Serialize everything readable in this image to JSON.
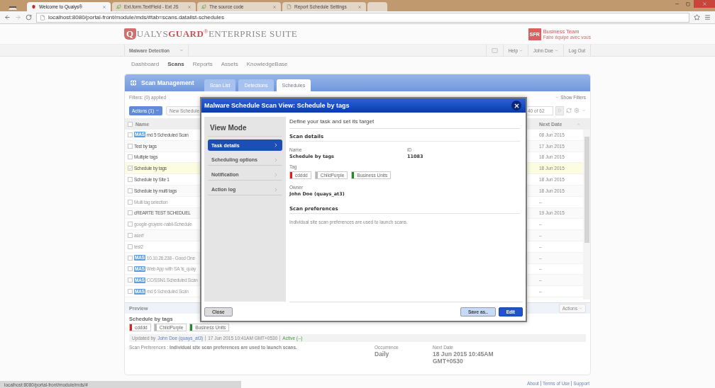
{
  "browser": {
    "tabs": [
      {
        "title": "Welcome to Qualys®",
        "kind": "shield",
        "selected": true
      },
      {
        "title": "Ext.form.TextField - Ext JS",
        "kind": "leaf",
        "selected": false
      },
      {
        "title": "The source code",
        "kind": "leaf",
        "selected": false
      },
      {
        "title": "Report Schedule Settings",
        "kind": "page",
        "selected": false
      }
    ],
    "address": "localhost:8080/portal-front/module/mds/#tab=scans.datalist-schedules"
  },
  "header": {
    "logo": {
      "mark": "Q",
      "part_1": "UALYS",
      "part_2": "GUARD",
      "registered": "®",
      "part_3": "ENTERPRISE SUITE"
    },
    "partner": {
      "mark": "SFR",
      "name": "Business Team",
      "tagline": "Faire équipe avec vous"
    },
    "app_switcher": "Malware Detection",
    "user_menu": [
      "Help",
      "John Doe"
    ],
    "logout": "Log Out"
  },
  "menu": [
    {
      "label": "Dashboard",
      "selected": false
    },
    {
      "label": "Scans",
      "selected": true
    },
    {
      "label": "Reports",
      "selected": false
    },
    {
      "label": "Assets",
      "selected": false
    },
    {
      "label": "KnowledgeBase",
      "selected": false
    }
  ],
  "panel": {
    "title": "Scan Management",
    "tabs": [
      {
        "label": "Scan List",
        "selected": false
      },
      {
        "label": "Detections",
        "selected": false
      },
      {
        "label": "Schedules",
        "selected": true
      }
    ],
    "filters": "Filters: (0) applied",
    "show_filters": "Show Filters",
    "actions_button": "Actions (1)",
    "new_button": "New Schedule",
    "pager": "40 of 62",
    "columns": [
      "Name",
      "Next Date"
    ],
    "all_checked": false,
    "rows": [
      {
        "badge": "MAS",
        "name": "md 5 Scheduled Scan",
        "next_date": "08 Jun 2015",
        "checked": false,
        "inactive": false
      },
      {
        "name": "Test by tags",
        "next_date": "17 Jun 2015",
        "checked": false,
        "inactive": false
      },
      {
        "name": "Multiple tags",
        "next_date": "18 Jun 2015",
        "checked": false,
        "inactive": false
      },
      {
        "name": "Schedule by tags",
        "next_date": "18 Jun 2015",
        "checked": true,
        "inactive": false
      },
      {
        "name": "Schedule by Site 1",
        "next_date": "18 Jun 2015",
        "checked": false,
        "inactive": false
      },
      {
        "name": "Schedule by multi tags",
        "next_date": "18 Jun 2015",
        "checked": false,
        "inactive": false
      },
      {
        "name": "Multi tag selection",
        "next_date": "–",
        "checked": false,
        "inactive": true
      },
      {
        "name": "cREARTE TEST SCHEDUEL",
        "next_date": "19 Jun 2015",
        "checked": false,
        "inactive": false
      },
      {
        "name": "google-gruyere-nabil-Schedule",
        "next_date": "–",
        "checked": false,
        "inactive": true
      },
      {
        "name": "aserf",
        "next_date": "–",
        "checked": false,
        "inactive": true
      },
      {
        "name": "test2",
        "next_date": "–",
        "checked": false,
        "inactive": true
      },
      {
        "badge": "MAS",
        "name": "10.10.26.238 - Good One",
        "next_date": "–",
        "checked": false,
        "inactive": true
      },
      {
        "badge": "MAS",
        "name": "Web App with SA 'is_quay",
        "next_date": "–",
        "checked": false,
        "inactive": true
      },
      {
        "badge": "MAS",
        "name": "CC/SSN1 Scheduled Scan",
        "next_date": "–",
        "checked": false,
        "inactive": true
      },
      {
        "badge": "MAS",
        "name": "md 6 Scheduled Scan",
        "next_date": "–",
        "checked": false,
        "inactive": true
      }
    ]
  },
  "preview": {
    "title": "Preview",
    "actions": "Actions",
    "name": "Schedule by tags",
    "tags": [
      {
        "label": "cdddd",
        "color": "#e02020"
      },
      {
        "label": "ChildPurple",
        "color": "#b8b8b8"
      },
      {
        "label": "Business Units",
        "color": "#1e8c2a"
      }
    ],
    "updated_label": "Updated by",
    "updated_by": "John Doe (quays_at3)",
    "updated_at": "17 Jun 2015 10:41AM GMT+0530",
    "status": "Active (--)",
    "preferences_label": "Scan Preferences :",
    "preferences": "Individual site scan preferences are used to launch scans.",
    "occurrence_label": "Occurrence",
    "occurrence": "Daily",
    "next_date_label": "Next Date",
    "next_date": "18 Jun 2015 10:45AM GMT+0530"
  },
  "modal": {
    "title": "Malware Schedule Scan View: Schedule by tags",
    "mode": "View Mode",
    "nav": [
      {
        "label": "Task details",
        "selected": true
      },
      {
        "label": "Scheduling options",
        "selected": false
      },
      {
        "label": "Notification",
        "selected": false
      },
      {
        "label": "Action log",
        "selected": false
      }
    ],
    "intro": "Define your task and set its target",
    "section_1": "Scan details",
    "name_label": "Name",
    "name": "Schedule by tags",
    "id_label": "ID",
    "id": "11083",
    "tag_label": "Tag",
    "tags": [
      {
        "label": "cdddd",
        "color": "#e02020"
      },
      {
        "label": "ChildPurple",
        "color": "#b8b8b8"
      },
      {
        "label": "Business Units",
        "color": "#1e8c2a"
      }
    ],
    "owner_label": "Owner",
    "owner": "John Doe (quays_at3)",
    "section_2": "Scan preferences",
    "preferences": "Individual site scan preferences are used to launch scans.",
    "buttons": {
      "close": "Close",
      "save_as": "Save as..",
      "edit": "Edit"
    }
  },
  "status_url": "localhost:8080/portal-front/module/mds/#",
  "footer_links": [
    "About",
    "Terms of Use",
    "Support"
  ]
}
